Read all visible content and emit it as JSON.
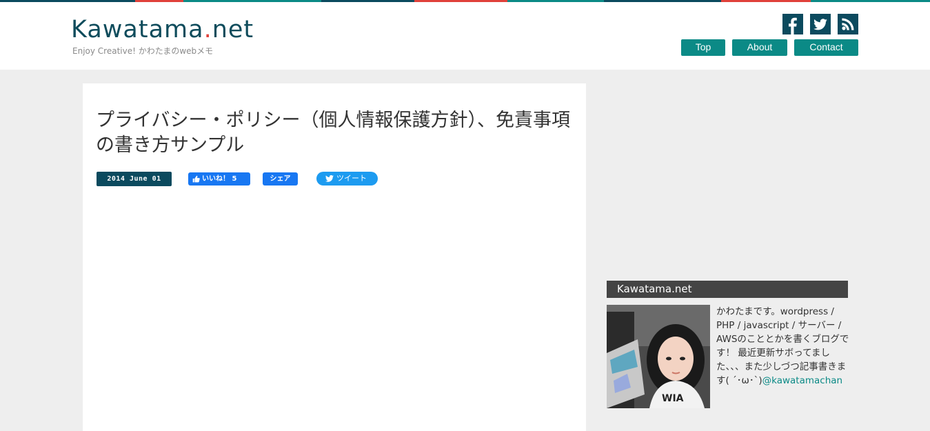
{
  "topstripe": [
    "#0b4a5e",
    "#e0413a",
    "#0b8a86",
    "#0b4a5e",
    "#e0413a",
    "#0b8a86",
    "#0b4a5e",
    "#e0413a",
    "#0b8a86",
    "#0b4a5e"
  ],
  "header": {
    "logo_main": "Kawatama",
    "logo_dot": ".",
    "logo_tld": "net",
    "tagline": "Enjoy Creative! かわたまのwebメモ",
    "social_icons": [
      "facebook-icon",
      "twitter-icon",
      "rss-icon"
    ]
  },
  "nav": {
    "top": "Top",
    "about": "About",
    "contact": "Contact"
  },
  "article": {
    "title": "プライバシー・ポリシー（個人情報保護方針）、免責事項の書き方サンプル",
    "date": "2014 June 01",
    "like_label": "いいね！ 5",
    "share_label": "シェア",
    "tweet_label": "ツイート"
  },
  "sidebar": {
    "widget_title": "Kawatama.net",
    "bio_text": "かわたまです。wordpress / PHP / javascript / サーバー / AWSのこととかを書くブログです！ 最近更新サボってました、、、また少しづつ記事書きます( ´･ω･`)",
    "bio_link": "@kawatamachan"
  },
  "colors": {
    "brand_dark": "#0b4a5e",
    "brand_teal": "#0b8a86",
    "accent_red": "#e0413a",
    "facebook": "#1877f2",
    "twitter": "#1d9bf0"
  }
}
